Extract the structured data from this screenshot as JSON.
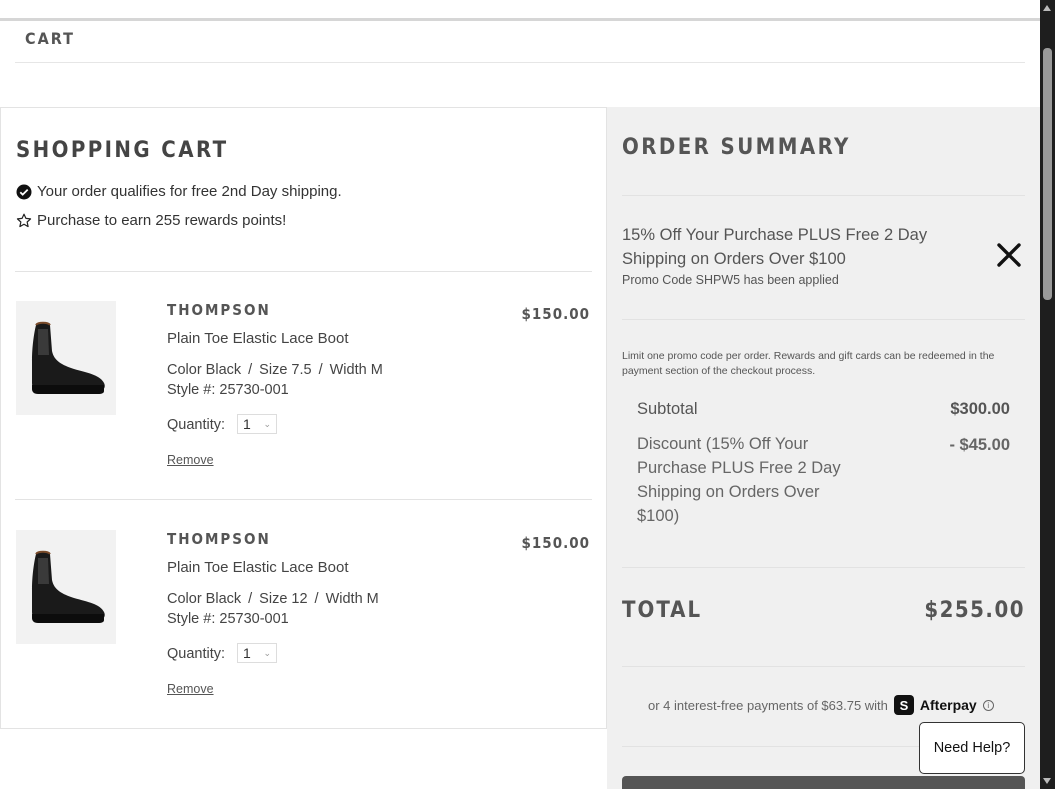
{
  "breadcrumb": {
    "label": "CART"
  },
  "cart": {
    "title": "SHOPPING CART",
    "notes": {
      "shipping": "Your order qualifies for free 2nd Day shipping.",
      "rewards": "Purchase to earn 255 rewards points!"
    },
    "items": [
      {
        "brand": "THOMPSON",
        "name": "Plain Toe Elastic Lace Boot",
        "color": "Color Black",
        "size": "Size 7.5",
        "width": "Width M",
        "style": "Style #: 25730-001",
        "quantity_label": "Quantity:",
        "quantity": "1",
        "remove_label": "Remove",
        "price": "$150.00",
        "image_icon": "boot-icon"
      },
      {
        "brand": "THOMPSON",
        "name": "Plain Toe Elastic Lace Boot",
        "color": "Color Black",
        "size": "Size 12",
        "width": "Width M",
        "style": "Style #: 25730-001",
        "quantity_label": "Quantity:",
        "quantity": "1",
        "remove_label": "Remove",
        "price": "$150.00",
        "image_icon": "boot-icon"
      }
    ],
    "separator": "/"
  },
  "summary": {
    "title": "ORDER SUMMARY",
    "promo": {
      "description": "15% Off Your Purchase PLUS Free 2 Day Shipping on Orders Over $100",
      "applied": "Promo Code SHPW5 has been applied"
    },
    "limit_note": "Limit one promo code per order. Rewards and gift cards can be redeemed in the payment section of the checkout process.",
    "subtotal_label": "Subtotal",
    "subtotal_value": "$300.00",
    "discount_label": "Discount (15% Off Your Purchase PLUS Free 2 Day Shipping on Orders Over $100)",
    "discount_value": "- $45.00",
    "total_label": "TOTAL",
    "total_value": "$255.00",
    "afterpay": {
      "text": "or 4 interest-free payments of $63.75 with",
      "logo_glyph": "S",
      "brand": "Afterpay",
      "info_glyph": "i"
    }
  },
  "help": {
    "label": "Need Help?"
  },
  "colors": {
    "summary_bg": "#f0f0f0",
    "heading": "#555555",
    "checkout_button": "#555555"
  }
}
